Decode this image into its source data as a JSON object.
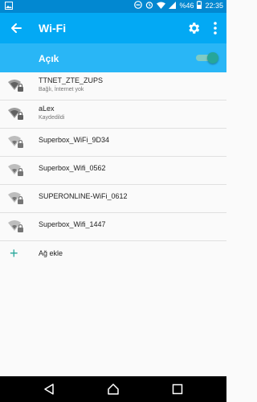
{
  "status": {
    "time": "22:35",
    "battery": "%46",
    "icons": [
      "image-icon",
      "minus-circle-icon",
      "alarm-icon",
      "wifi-icon",
      "signal-icon",
      "battery-icon"
    ]
  },
  "appbar": {
    "title": "Wi-Fi",
    "back_icon": "arrow-left-icon",
    "settings_icon": "gear-icon",
    "more_icon": "more-vert-icon"
  },
  "toggle": {
    "label": "Açık",
    "state": "on",
    "accent": "#26a69a"
  },
  "networks": [
    {
      "name": "TTNET_ZTE_ZUPS",
      "status": "Bağlı, İnternet yok"
    },
    {
      "name": "aLex",
      "status": "Kaydedildi"
    },
    {
      "name": "Superbox_WiFi_9D34",
      "status": ""
    },
    {
      "name": "Superbox_Wifi_0562",
      "status": ""
    },
    {
      "name": "SUPERONLINE-WiFi_0612",
      "status": ""
    },
    {
      "name": "Superbox_Wifi_1447",
      "status": ""
    }
  ],
  "add_network": {
    "label": "Ağ ekle",
    "icon": "plus-icon"
  },
  "navbar": {
    "back_icon": "nav-back-icon",
    "home_icon": "nav-home-icon",
    "recents_icon": "nav-recents-icon"
  }
}
